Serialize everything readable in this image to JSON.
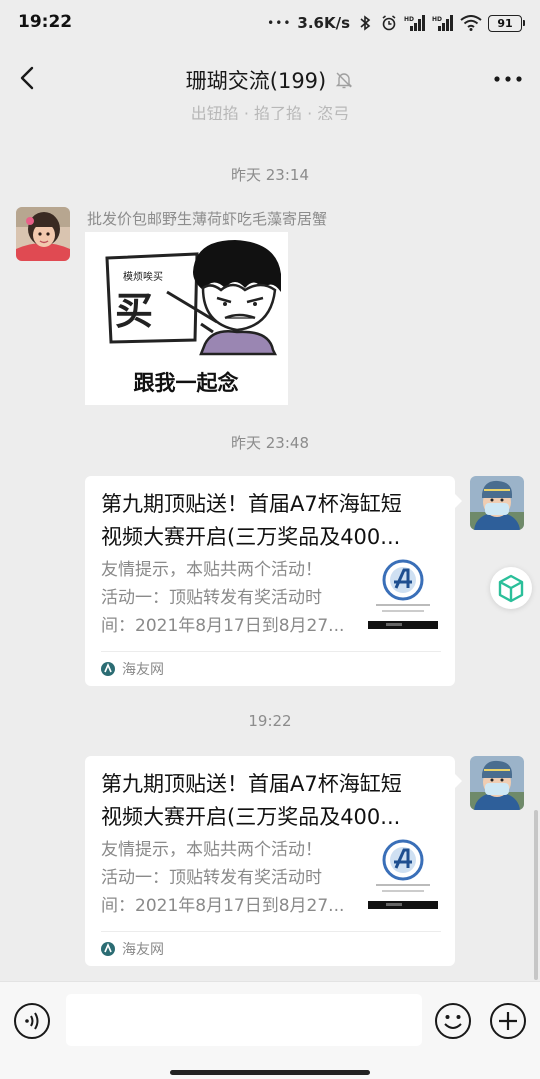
{
  "status_bar": {
    "time": "19:22",
    "dots": "•••",
    "speed": "3.6K/s",
    "battery": "91",
    "icons": [
      "bluetooth-icon",
      "alarm-icon",
      "hd-signal-icon",
      "hd-signal-icon",
      "wifi-icon"
    ]
  },
  "header": {
    "title": "珊瑚交流(199)",
    "mute_icon": "muted-bell-icon",
    "back_icon": "chevron-left-icon",
    "more_icon": "more-dots-icon"
  },
  "partial_top_text": "出钮掐 · 掐了掐 · 恣弓",
  "messages": [
    {
      "type": "timestamp",
      "text": "昨天 23:14"
    },
    {
      "type": "sticker",
      "sender_name": "批发价包邮野生薄荷虾吃毛藻寄居蟹",
      "sticker_board_small": "模烦唉买",
      "sticker_board_big": "买",
      "sticker_caption": "跟我一起念"
    },
    {
      "type": "timestamp",
      "text": "昨天 23:48"
    },
    {
      "type": "link_card",
      "title_lines": [
        "第九期顶贴送！首届A7杯海缸短",
        "视频大赛开启(三万奖品及400..."
      ],
      "desc_lines": [
        "友情提示，本贴共两个活动！",
        "活动一：顶贴转发有奖活动时",
        "间：2021年8月17日到8月27..."
      ],
      "source": "海友网"
    },
    {
      "type": "timestamp",
      "text": "19:22"
    },
    {
      "type": "link_card",
      "title_lines": [
        "第九期顶贴送！首届A7杯海缸短",
        "视频大赛开启(三万奖品及400..."
      ],
      "desc_lines": [
        "友情提示，本贴共两个活动！",
        "活动一：顶贴转发有奖活动时",
        "间：2021年8月17日到8月27..."
      ],
      "source": "海友网"
    }
  ],
  "input_bar": {
    "placeholder": "",
    "voice_icon": "voice-icon",
    "emoji_icon": "emoji-icon",
    "plus_icon": "plus-icon"
  },
  "colors": {
    "background": "#ededed",
    "card": "#ffffff",
    "secondary_text": "#8c8c8c",
    "floating_accent": "#2bbf9a"
  }
}
